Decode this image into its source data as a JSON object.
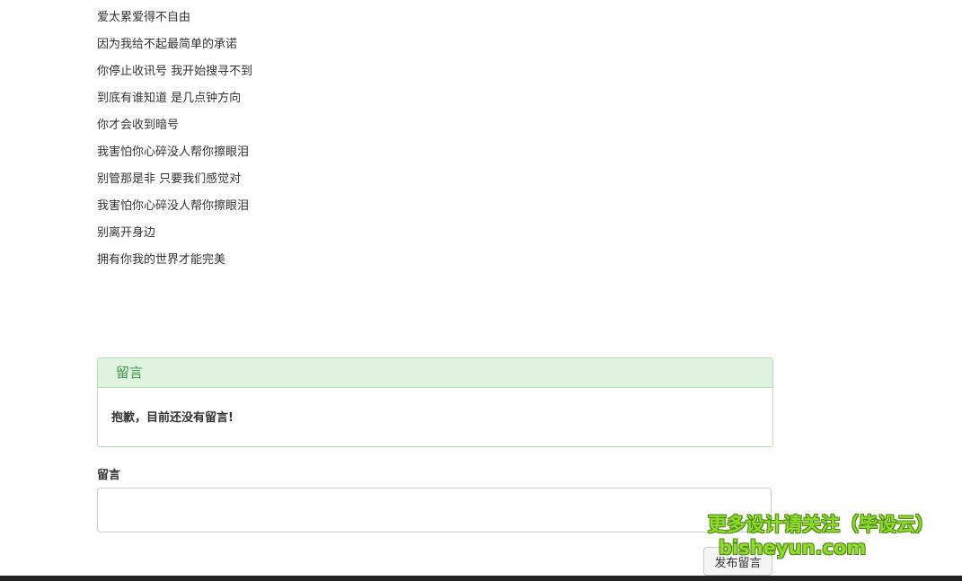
{
  "lyrics": [
    "爱太累爱得不自由",
    "因为我给不起最简单的承诺",
    "你停止收讯号 我开始搜寻不到",
    "到底有谁知道 是几点钟方向",
    "你才会收到暗号",
    "我害怕你心碎没人帮你擦眼泪",
    "别管那是非 只要我们感觉对",
    "我害怕你心碎没人帮你擦眼泪",
    "别离开身边",
    "拥有你我的世界才能完美"
  ],
  "comments_panel": {
    "title": "留言",
    "empty_message": "抱歉，目前还没有留言!"
  },
  "comment_form": {
    "label": "留言",
    "textarea_value": "",
    "submit_label": "发布留言"
  },
  "watermark": {
    "line1": "更多设计请关注（毕设云）",
    "line2": "bisheyun.com"
  },
  "colors": {
    "panel_header_bg": "#dff3de",
    "panel_border": "#b2dfb3",
    "panel_title": "#3c9a40",
    "watermark_green": "#8fdc2c",
    "footer_bar": "#222222"
  }
}
